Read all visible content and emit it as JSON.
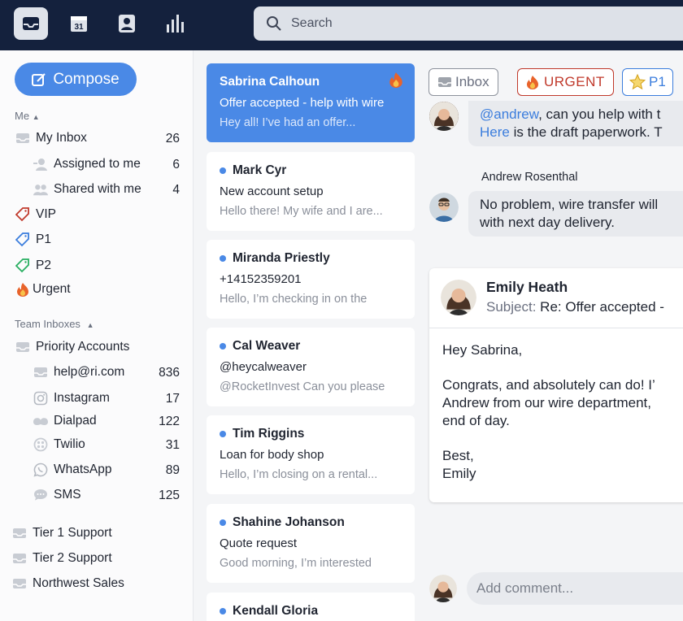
{
  "search": {
    "placeholder": "Search"
  },
  "sidebar": {
    "compose_label": "Compose",
    "me_label": "Me",
    "team_label": "Team Inboxes",
    "my_inbox": {
      "label": "My Inbox",
      "count": "26"
    },
    "assigned": {
      "label": "Assigned to me",
      "count": "6"
    },
    "shared": {
      "label": "Shared with me",
      "count": "4"
    },
    "tags": [
      {
        "label": "VIP",
        "color": "#c0392b"
      },
      {
        "label": "P1",
        "color": "#3b7ddd"
      },
      {
        "label": "P2",
        "color": "#27ae60"
      },
      {
        "label": "Urgent",
        "color": "#e67e22"
      }
    ],
    "priority": {
      "label": "Priority Accounts"
    },
    "channels": [
      {
        "label": "help@ri.com",
        "count": "836",
        "icon": "envelope-icon"
      },
      {
        "label": "Instagram",
        "count": "17",
        "icon": "instagram-icon"
      },
      {
        "label": "Dialpad",
        "count": "122",
        "icon": "dialpad-icon"
      },
      {
        "label": "Twilio",
        "count": "31",
        "icon": "twilio-icon"
      },
      {
        "label": "WhatsApp",
        "count": "89",
        "icon": "whatsapp-icon"
      },
      {
        "label": "SMS",
        "count": "125",
        "icon": "sms-icon"
      }
    ],
    "teams": [
      {
        "label": "Tier 1 Support"
      },
      {
        "label": "Tier 2 Support"
      },
      {
        "label": "Northwest Sales"
      }
    ]
  },
  "conversations": [
    {
      "name": "Sabrina Calhoun",
      "subject": "Offer accepted - help with wire",
      "preview": "Hey all! I’ve had an offer...",
      "active": true
    },
    {
      "name": "Mark Cyr",
      "subject": "New account setup",
      "preview": "Hello there! My wife and I are..."
    },
    {
      "name": "Miranda Priestly",
      "subject": "+14152359201",
      "preview": "Hello, I’m checking in on the"
    },
    {
      "name": "Cal Weaver",
      "subject": "@heycalweaver",
      "preview": "@RocketInvest Can you please"
    },
    {
      "name": "Tim Riggins",
      "subject": "Loan for body shop",
      "preview": "Hello, I’m closing on a rental..."
    },
    {
      "name": "Shahine Johanson",
      "subject": "Quote request",
      "preview": "Good morning, I’m interested"
    },
    {
      "name": "Kendall Gloria",
      "subject": "",
      "preview": ""
    }
  ],
  "detail": {
    "tags": {
      "inbox": "Inbox",
      "urgent": "URGENT",
      "p1": "P1"
    },
    "msg1": {
      "mention": "@andrew",
      "line1_rest": ", can you help with t",
      "link": "Here",
      "line2_rest": " is the draft paperwork. T"
    },
    "msg2": {
      "author": "Andrew Rosenthal",
      "line1": "No problem, wire transfer will",
      "line2": "with next day delivery."
    },
    "email": {
      "from": "Emily Heath",
      "subject_label": "Subject:",
      "subject": "Re: Offer accepted -",
      "greeting": "Hey Sabrina,",
      "line1": "Congrats, and absolutely can do! I’",
      "line2": "Andrew from our wire department,",
      "line3": "end of day.",
      "signoff": "Best,",
      "signature": "Emily"
    },
    "comment_placeholder": "Add comment..."
  }
}
